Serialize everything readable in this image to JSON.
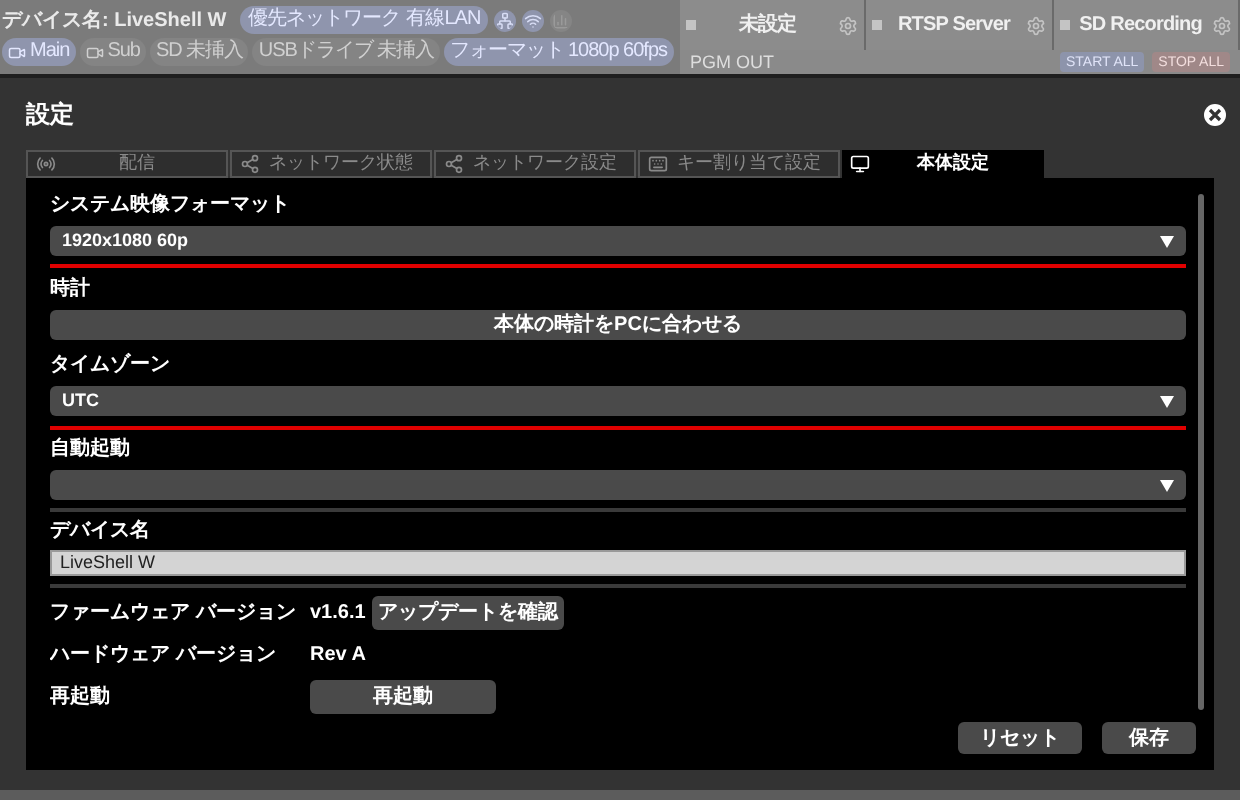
{
  "background": {
    "device_name": "デバイス名: LiveShell W",
    "status_chips": [
      {
        "label": "優先ネットワーク",
        "value": "有線LAN",
        "disabled": false
      }
    ],
    "source_chips": [
      {
        "kind": "camera",
        "label": "Main",
        "disabled": false
      },
      {
        "kind": "camera",
        "label": "Sub",
        "disabled": true
      },
      {
        "kind": "text",
        "label": "SD",
        "value": "未挿入",
        "disabled": true
      },
      {
        "kind": "text",
        "label": "USBドライブ",
        "value": "未挿入",
        "disabled": true
      },
      {
        "kind": "text",
        "label": "フォーマット",
        "value": "1080p 60fps",
        "disabled": false
      }
    ],
    "output_tabs": [
      {
        "label": "未設定"
      },
      {
        "label": "RTSP Server"
      },
      {
        "label": "SD Recording"
      }
    ],
    "output_label": "PGM OUT",
    "start_all": "START ALL",
    "stop_all": "STOP ALL"
  },
  "dialog": {
    "title": "設定",
    "tabs": [
      {
        "kind": "broadcast",
        "label": "配信",
        "selected": false
      },
      {
        "kind": "network",
        "label": "ネットワーク状態",
        "selected": false
      },
      {
        "kind": "network",
        "label": "ネットワーク設定",
        "selected": false
      },
      {
        "kind": "keyboard",
        "label": "キー割り当て設定",
        "selected": false
      },
      {
        "kind": "device",
        "label": "本体設定",
        "selected": true
      }
    ],
    "items": [
      {
        "kind": "select",
        "label": "システム映像フォーマット",
        "value": "1920x1080 60p"
      },
      {
        "kind": "group",
        "highlighted": true,
        "children": [
          {
            "kind": "wide_button",
            "label": "時計",
            "button": "本体の時計をPCに合わせる"
          },
          {
            "kind": "select",
            "label": "タイムゾーン",
            "value": "UTC"
          }
        ]
      },
      {
        "kind": "select",
        "label": "自動起動"
      },
      {
        "kind": "divider"
      },
      {
        "kind": "input",
        "label": "デバイス名",
        "value": "LiveShell W"
      },
      {
        "kind": "divider"
      },
      {
        "kind": "info",
        "label": "ファームウェア バージョン",
        "value": "v1.6.1",
        "button": "アップデートを確認"
      },
      {
        "kind": "info",
        "label": "ハードウェア バージョン",
        "value": "Rev A"
      },
      {
        "kind": "info",
        "label": "再起動",
        "button": "再起動",
        "wide": true
      }
    ],
    "footer_buttons": [
      "リセット",
      "保存"
    ]
  }
}
